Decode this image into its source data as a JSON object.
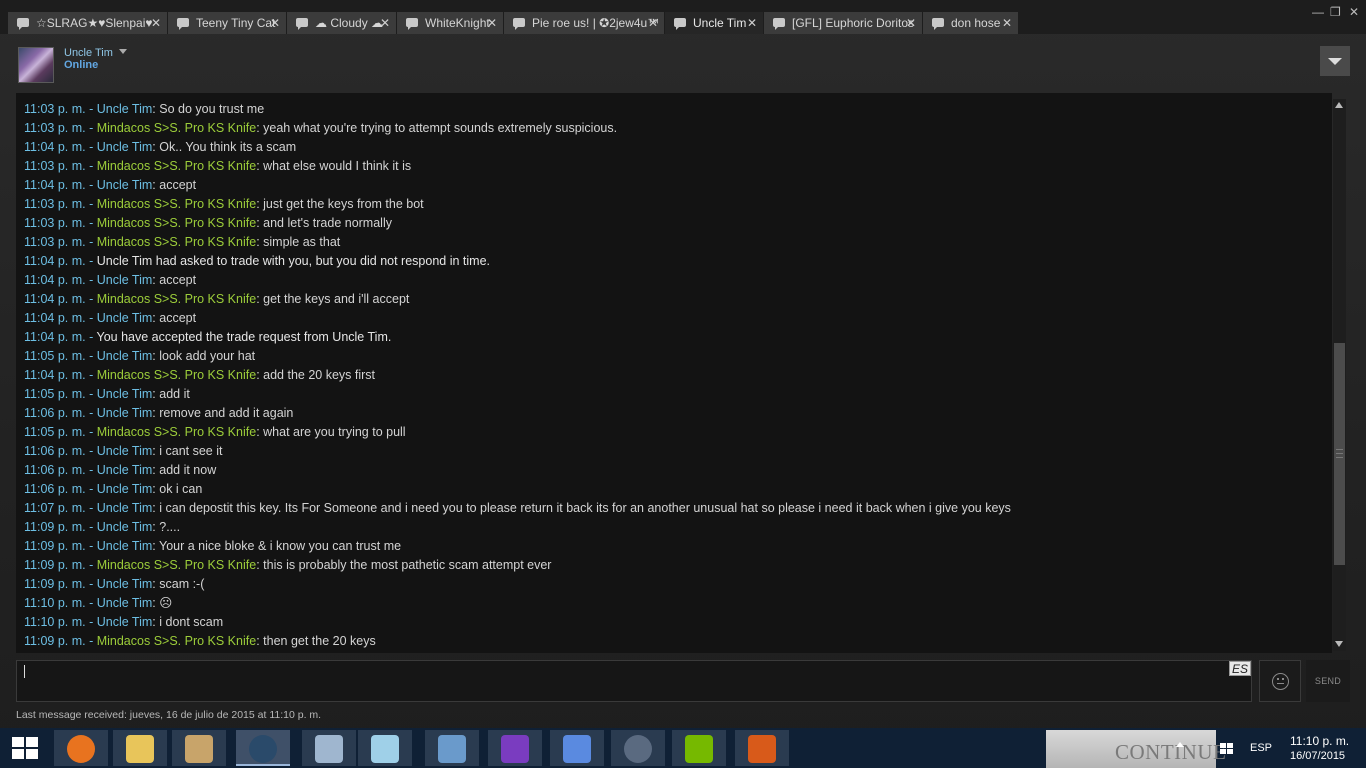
{
  "tabs": [
    {
      "label": "☆SLRAG★♥Slenpai♥",
      "active": false
    },
    {
      "label": "Teeny Tiny Cat",
      "active": false
    },
    {
      "label": "☁ Cloudy ☁",
      "active": false
    },
    {
      "label": "WhiteKnight",
      "active": false
    },
    {
      "label": "Pie roe us! | ✪2jew4u™",
      "active": false
    },
    {
      "label": "Uncle Tim",
      "active": true
    },
    {
      "label": "[GFL] Euphoric Doritos",
      "active": false
    },
    {
      "label": "don hose",
      "active": false
    }
  ],
  "window": {
    "minimize": "—",
    "restore": "❐",
    "close": "✕"
  },
  "friend": {
    "name": "Uncle Tim",
    "status": "Online"
  },
  "messages": [
    {
      "time": "11:03 p. m.",
      "sender": "Uncle Tim",
      "kind": "self",
      "text": "So do you trust me"
    },
    {
      "time": "11:03 p. m.",
      "sender": "Mindacos S>S. Pro KS Knife",
      "kind": "other",
      "text": "yeah what you're trying to attempt sounds extremely suspicious."
    },
    {
      "time": "11:04 p. m.",
      "sender": "Uncle Tim",
      "kind": "self",
      "text": "Ok.. You think its a scam"
    },
    {
      "time": "11:03 p. m.",
      "sender": "Mindacos S>S. Pro KS Knife",
      "kind": "other",
      "text": "what else would I think it is"
    },
    {
      "time": "11:04 p. m.",
      "sender": "Uncle Tim",
      "kind": "self",
      "text": "accept"
    },
    {
      "time": "11:03 p. m.",
      "sender": "Mindacos S>S. Pro KS Knife",
      "kind": "other",
      "text": "just get the keys from the bot"
    },
    {
      "time": "11:03 p. m.",
      "sender": "Mindacos S>S. Pro KS Knife",
      "kind": "other",
      "text": "and let's trade normally"
    },
    {
      "time": "11:03 p. m.",
      "sender": "Mindacos S>S. Pro KS Knife",
      "kind": "other",
      "text": "simple as that"
    },
    {
      "time": "11:04 p. m.",
      "sender": "",
      "kind": "system",
      "text": "Uncle Tim had asked to trade with you, but you did not respond in time."
    },
    {
      "time": "11:04 p. m.",
      "sender": "Uncle Tim",
      "kind": "self",
      "text": "accept"
    },
    {
      "time": "11:04 p. m.",
      "sender": "Mindacos S>S. Pro KS Knife",
      "kind": "other",
      "text": "get the keys and i'll accept"
    },
    {
      "time": "11:04 p. m.",
      "sender": "Uncle Tim",
      "kind": "self",
      "text": "accept"
    },
    {
      "time": "11:04 p. m.",
      "sender": "",
      "kind": "system",
      "text": "You have accepted the trade request from Uncle Tim."
    },
    {
      "time": "11:05 p. m.",
      "sender": "Uncle Tim",
      "kind": "self",
      "text": "look add your hat"
    },
    {
      "time": "11:04 p. m.",
      "sender": "Mindacos S>S. Pro KS Knife",
      "kind": "other",
      "text": "add the 20 keys first"
    },
    {
      "time": "11:05 p. m.",
      "sender": "Uncle Tim",
      "kind": "self",
      "text": "add it"
    },
    {
      "time": "11:06 p. m.",
      "sender": "Uncle Tim",
      "kind": "self",
      "text": "remove and add it again"
    },
    {
      "time": "11:05 p. m.",
      "sender": "Mindacos S>S. Pro KS Knife",
      "kind": "other",
      "text": "what are you trying to pull"
    },
    {
      "time": "11:06 p. m.",
      "sender": "Uncle Tim",
      "kind": "self",
      "text": "i cant see it"
    },
    {
      "time": "11:06 p. m.",
      "sender": "Uncle Tim",
      "kind": "self",
      "text": "add it now"
    },
    {
      "time": "11:06 p. m.",
      "sender": "Uncle Tim",
      "kind": "self",
      "text": "ok i can"
    },
    {
      "time": "11:07 p. m.",
      "sender": "Uncle Tim",
      "kind": "self",
      "text": "i can depostit this key. Its For Someone and i need you to please return it back its for an another unusual hat so please i need it back when i give you keys"
    },
    {
      "time": "11:09 p. m.",
      "sender": "Uncle Tim",
      "kind": "self",
      "text": "?...."
    },
    {
      "time": "11:09 p. m.",
      "sender": "Uncle Tim",
      "kind": "self",
      "text": "Your a nice bloke & i know you can trust me"
    },
    {
      "time": "11:09 p. m.",
      "sender": "Mindacos S>S. Pro KS Knife",
      "kind": "other",
      "text": "this is probably the most pathetic scam attempt ever"
    },
    {
      "time": "11:09 p. m.",
      "sender": "Uncle Tim",
      "kind": "self",
      "text": "scam :-("
    },
    {
      "time": "11:10 p. m.",
      "sender": "Uncle Tim",
      "kind": "self",
      "text": "☹"
    },
    {
      "time": "11:10 p. m.",
      "sender": "Uncle Tim",
      "kind": "self",
      "text": "i dont scam"
    },
    {
      "time": "11:09 p. m.",
      "sender": "Mindacos S>S. Pro KS Knife",
      "kind": "other",
      "text": "then get the 20 keys"
    }
  ],
  "input": {
    "value": "",
    "ime_indicator": "ES"
  },
  "buttons": {
    "send": "SEND"
  },
  "footer": {
    "last_message": "Last message received: jueves, 16 de julio de 2015 at 11:10 p. m."
  },
  "taskbar": {
    "apps": [
      "windows-start-icon",
      "firefox-icon",
      "file-explorer-icon",
      "paint-icon",
      "steam-icon",
      "resource-monitor-icon",
      "notepad-icon",
      "calculator-icon",
      "emulator-icon",
      "photo-viewer-icon",
      "teamspeak-icon",
      "nvidia-icon",
      "team-fortress-icon"
    ],
    "overlay_text": "CONTINUE",
    "language": "ESP",
    "time": "11:10 p. m.",
    "date": "16/07/2015"
  },
  "colors": {
    "timestamp": "#6dbfe4",
    "self_name": "#6dbfe4",
    "other_name": "#9ccd3a",
    "status_online": "#62a7e3"
  }
}
